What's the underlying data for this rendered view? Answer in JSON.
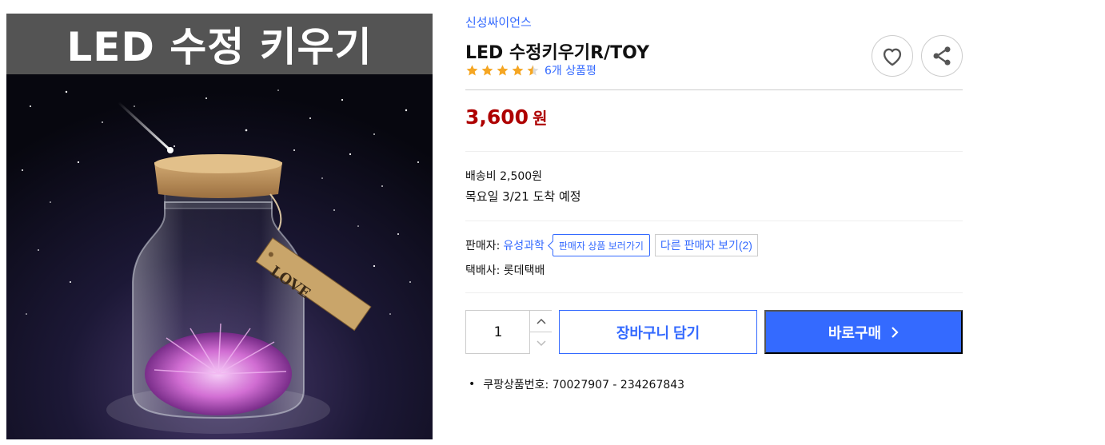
{
  "product_image": {
    "banner_text": "LED 수정 키우기",
    "tag_text": "LOVE"
  },
  "brand": "신성싸이언스",
  "title": "LED 수정키우기R/TOY",
  "rating": {
    "stars": 4.5,
    "max_stars": 5,
    "review_count_label": "6개 상품평"
  },
  "icons": {
    "wishlist": "heart-icon",
    "share": "share-icon"
  },
  "price": {
    "value": "3,600",
    "unit": "원"
  },
  "shipping": {
    "fee_label": "배송비 2,500원",
    "arrival_label": "목요일  3/21  도착  예정"
  },
  "seller": {
    "prefix": "판매자:",
    "name": "유성과학",
    "products_button": "판매자 상품 보러가기",
    "other_sellers_button": "다른 판매자 보기(2)"
  },
  "courier": {
    "label": "택배사: 롯데택배"
  },
  "purchase": {
    "quantity": "1",
    "cart_button": "장바구니 담기",
    "buy_button": "바로구매"
  },
  "item_number": {
    "label": "쿠팡상품번호: 70027907 - 234267843"
  },
  "colors": {
    "accent_blue": "#346aff",
    "price_red": "#ae0000",
    "star_orange": "#f5a623"
  }
}
